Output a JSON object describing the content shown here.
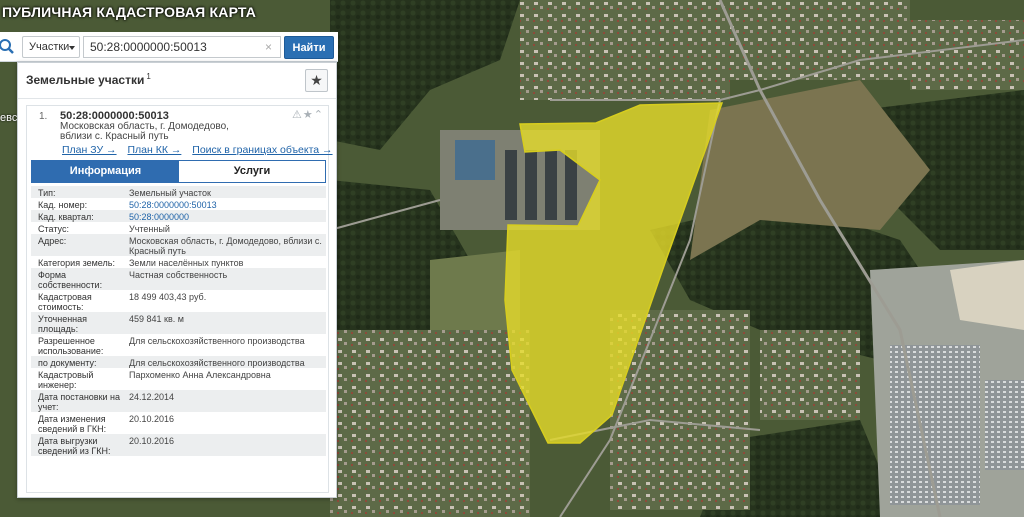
{
  "app": {
    "title": "ПУБЛИЧНАЯ КАДАСТРОВАЯ КАРТА"
  },
  "map": {
    "edge_label": "евс",
    "parcel_color": "#e6dc2a"
  },
  "search": {
    "type_label": "Участки",
    "query": "50:28:0000000:50013",
    "clear_symbol": "×",
    "button_label": "Найти"
  },
  "panel": {
    "title": "Земельные участки",
    "count": "1",
    "star_symbol": "★",
    "result": {
      "number": "1.",
      "id": "50:28:0000000:50013",
      "address": "Московская область, г. Домодедово, вблизи с. Красный путь",
      "tools": "⚠★⌃"
    },
    "links": {
      "plan_zu": "План ЗУ →",
      "plan_kk": "План КК →",
      "search_in": "Поиск в границах объекта →"
    },
    "tabs": {
      "info": "Информация",
      "services": "Услуги"
    },
    "attributes": [
      {
        "key": "Тип:",
        "value": "Земельный участок"
      },
      {
        "key": "Кад. номер:",
        "value": "50:28:0000000:50013",
        "link": true
      },
      {
        "key": "Кад. квартал:",
        "value": "50:28:0000000",
        "link": true
      },
      {
        "key": "Статус:",
        "value": "Учтенный"
      },
      {
        "key": "Адрес:",
        "value": "Московская область, г. Домодедово, вблизи с. Красный путь"
      },
      {
        "key": "Категория земель:",
        "value": "Земли населённых пунктов"
      },
      {
        "key": "Форма собственности:",
        "value": "Частная собственность"
      },
      {
        "key": "Кадастровая стоимость:",
        "value": "18 499 403,43 руб."
      },
      {
        "key": "Уточненная площадь:",
        "value": "459 841 кв. м"
      },
      {
        "key": "Разрешенное использование:",
        "value": "Для сельскохозяйственного производства"
      },
      {
        "key": "по документу:",
        "value": "Для сельскохозяйственного производства"
      },
      {
        "key": "Кадастровый инженер:",
        "value": "Пархоменко Анна Александровна"
      },
      {
        "key": "Дата постановки на учет:",
        "value": "24.12.2014"
      },
      {
        "key": "Дата изменения сведений в ГКН:",
        "value": "20.10.2016"
      },
      {
        "key": "Дата выгрузки сведений из ГКН:",
        "value": "20.10.2016"
      }
    ]
  }
}
